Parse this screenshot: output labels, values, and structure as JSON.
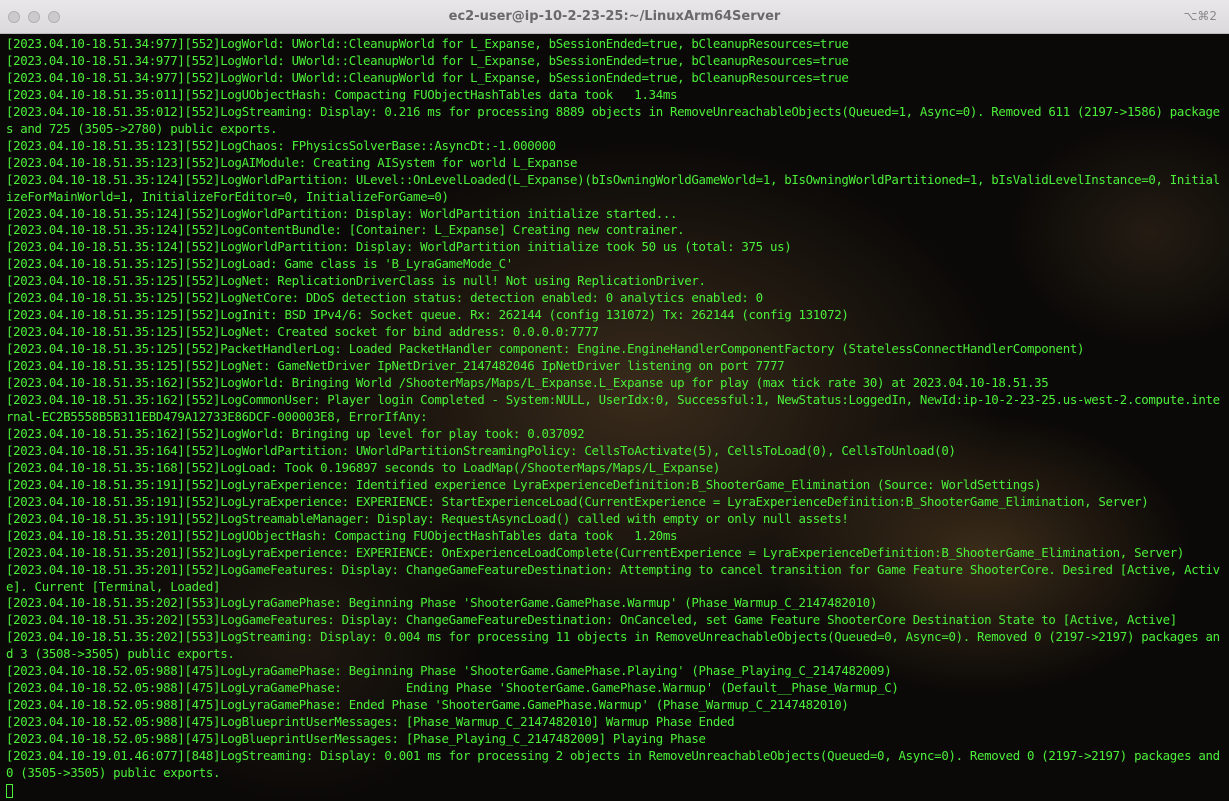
{
  "window": {
    "title": "ec2-user@ip-10-2-23-25:~/LinuxArm64Server",
    "shortcut": "⌥⌘2",
    "buttons": [
      "close",
      "minimize",
      "zoom"
    ]
  },
  "terminal": {
    "text_color": "#4cf03a",
    "lines": [
      "[2023.04.10-18.51.34:977][552]LogWorld: UWorld::CleanupWorld for L_Expanse, bSessionEnded=true, bCleanupResources=true",
      "[2023.04.10-18.51.34:977][552]LogWorld: UWorld::CleanupWorld for L_Expanse, bSessionEnded=true, bCleanupResources=true",
      "[2023.04.10-18.51.34:977][552]LogWorld: UWorld::CleanupWorld for L_Expanse, bSessionEnded=true, bCleanupResources=true",
      "[2023.04.10-18.51.35:011][552]LogUObjectHash: Compacting FUObjectHashTables data took   1.34ms",
      "[2023.04.10-18.51.35:012][552]LogStreaming: Display: 0.216 ms for processing 8889 objects in RemoveUnreachableObjects(Queued=1, Async=0). Removed 611 (2197->1586) packages and 725 (3505->2780) public exports.",
      "[2023.04.10-18.51.35:123][552]LogChaos: FPhysicsSolverBase::AsyncDt:-1.000000",
      "[2023.04.10-18.51.35:123][552]LogAIModule: Creating AISystem for world L_Expanse",
      "[2023.04.10-18.51.35:124][552]LogWorldPartition: ULevel::OnLevelLoaded(L_Expanse)(bIsOwningWorldGameWorld=1, bIsOwningWorldPartitioned=1, bIsValidLevelInstance=0, InitializeForMainWorld=1, InitializeForEditor=0, InitializeForGame=0)",
      "[2023.04.10-18.51.35:124][552]LogWorldPartition: Display: WorldPartition initialize started...",
      "[2023.04.10-18.51.35:124][552]LogContentBundle: [Container: L_Expanse] Creating new contrainer.",
      "[2023.04.10-18.51.35:124][552]LogWorldPartition: Display: WorldPartition initialize took 50 us (total: 375 us)",
      "[2023.04.10-18.51.35:125][552]LogLoad: Game class is 'B_LyraGameMode_C'",
      "[2023.04.10-18.51.35:125][552]LogNet: ReplicationDriverClass is null! Not using ReplicationDriver.",
      "[2023.04.10-18.51.35:125][552]LogNetCore: DDoS detection status: detection enabled: 0 analytics enabled: 0",
      "[2023.04.10-18.51.35:125][552]LogInit: BSD IPv4/6: Socket queue. Rx: 262144 (config 131072) Tx: 262144 (config 131072)",
      "[2023.04.10-18.51.35:125][552]LogNet: Created socket for bind address: 0.0.0.0:7777",
      "[2023.04.10-18.51.35:125][552]PacketHandlerLog: Loaded PacketHandler component: Engine.EngineHandlerComponentFactory (StatelessConnectHandlerComponent)",
      "[2023.04.10-18.51.35:125][552]LogNet: GameNetDriver IpNetDriver_2147482046 IpNetDriver listening on port 7777",
      "[2023.04.10-18.51.35:162][552]LogWorld: Bringing World /ShooterMaps/Maps/L_Expanse.L_Expanse up for play (max tick rate 30) at 2023.04.10-18.51.35",
      "[2023.04.10-18.51.35:162][552]LogCommonUser: Player login Completed - System:NULL, UserIdx:0, Successful:1, NewStatus:LoggedIn, NewId:ip-10-2-23-25.us-west-2.compute.internal-EC2B5558B5B311EBD479A12733E86DCF-000003E8, ErrorIfAny:",
      "[2023.04.10-18.51.35:162][552]LogWorld: Bringing up level for play took: 0.037092",
      "[2023.04.10-18.51.35:164][552]LogWorldPartition: UWorldPartitionStreamingPolicy: CellsToActivate(5), CellsToLoad(0), CellsToUnload(0)",
      "[2023.04.10-18.51.35:168][552]LogLoad: Took 0.196897 seconds to LoadMap(/ShooterMaps/Maps/L_Expanse)",
      "[2023.04.10-18.51.35:191][552]LogLyraExperience: Identified experience LyraExperienceDefinition:B_ShooterGame_Elimination (Source: WorldSettings)",
      "[2023.04.10-18.51.35:191][552]LogLyraExperience: EXPERIENCE: StartExperienceLoad(CurrentExperience = LyraExperienceDefinition:B_ShooterGame_Elimination, Server)",
      "[2023.04.10-18.51.35:191][552]LogStreamableManager: Display: RequestAsyncLoad() called with empty or only null assets!",
      "[2023.04.10-18.51.35:201][552]LogUObjectHash: Compacting FUObjectHashTables data took   1.20ms",
      "[2023.04.10-18.51.35:201][552]LogLyraExperience: EXPERIENCE: OnExperienceLoadComplete(CurrentExperience = LyraExperienceDefinition:B_ShooterGame_Elimination, Server)",
      "[2023.04.10-18.51.35:201][552]LogGameFeatures: Display: ChangeGameFeatureDestination: Attempting to cancel transition for Game Feature ShooterCore. Desired [Active, Active]. Current [Terminal, Loaded]",
      "[2023.04.10-18.51.35:202][553]LogLyraGamePhase: Beginning Phase 'ShooterGame.GamePhase.Warmup' (Phase_Warmup_C_2147482010)",
      "[2023.04.10-18.51.35:202][553]LogGameFeatures: Display: ChangeGameFeatureDestination: OnCanceled, set Game Feature ShooterCore Destination State to [Active, Active]",
      "[2023.04.10-18.51.35:202][553]LogStreaming: Display: 0.004 ms for processing 11 objects in RemoveUnreachableObjects(Queued=0, Async=0). Removed 0 (2197->2197) packages and 3 (3508->3505) public exports.",
      "[2023.04.10-18.52.05:988][475]LogLyraGamePhase: Beginning Phase 'ShooterGame.GamePhase.Playing' (Phase_Playing_C_2147482009)",
      "[2023.04.10-18.52.05:988][475]LogLyraGamePhase:         Ending Phase 'ShooterGame.GamePhase.Warmup' (Default__Phase_Warmup_C)",
      "[2023.04.10-18.52.05:988][475]LogLyraGamePhase: Ended Phase 'ShooterGame.GamePhase.Warmup' (Phase_Warmup_C_2147482010)",
      "[2023.04.10-18.52.05:988][475]LogBlueprintUserMessages: [Phase_Warmup_C_2147482010] Warmup Phase Ended",
      "[2023.04.10-18.52.05:988][475]LogBlueprintUserMessages: [Phase_Playing_C_2147482009] Playing Phase",
      "[2023.04.10-19.01.46:077][848]LogStreaming: Display: 0.001 ms for processing 2 objects in RemoveUnreachableObjects(Queued=0, Async=0). Removed 0 (2197->2197) packages and 0 (3505->3505) public exports."
    ]
  }
}
